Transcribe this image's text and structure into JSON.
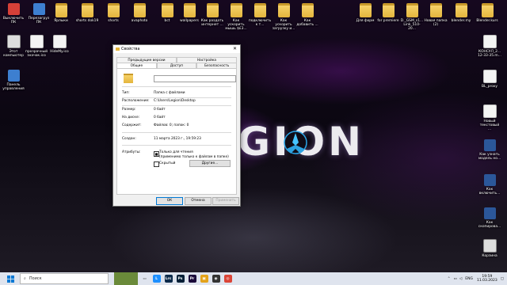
{
  "desktop": {
    "brand_text": "GION",
    "icons_top": [
      {
        "label": "Выключить ПК",
        "kind": "red"
      },
      {
        "label": "Перезагруз ПК",
        "kind": "blue"
      },
      {
        "label": "Ярлыки",
        "kind": "folder"
      },
      {
        "label": "shorts dok19",
        "kind": "folder"
      },
      {
        "label": "shorts",
        "kind": "folder"
      },
      {
        "label": "avaphoto",
        "kind": "folder"
      },
      {
        "label": "bct",
        "kind": "folder"
      },
      {
        "label": "wallpapers",
        "kind": "folder"
      },
      {
        "label": "Как раздать интернет ...",
        "kind": "folder"
      },
      {
        "label": "Как ускорить мышь $£3...",
        "kind": "folder"
      },
      {
        "label": "подключить к т...",
        "kind": "folder"
      },
      {
        "label": "Как ускорить загрузку и...",
        "kind": "folder"
      },
      {
        "label": "Как добавить ...",
        "kind": "folder"
      },
      {
        "label": "Для форм",
        "kind": "folder"
      },
      {
        "label": "for premiere",
        "kind": "folder"
      },
      {
        "label": "D._GSM_s1... Link_510-20...",
        "kind": "folder"
      },
      {
        "label": "Новая папка (2)",
        "kind": "folder"
      },
      {
        "label": "blender.my",
        "kind": "folder"
      },
      {
        "label": "Blender.kurs",
        "kind": "folder"
      }
    ],
    "icons_left": [
      {
        "label": "Этот компьютер",
        "kind": "exe"
      },
      {
        "label": "прозрачный значок.ico",
        "kind": "doc"
      },
      {
        "label": "HideMy.ico",
        "kind": "doc"
      },
      {
        "label": "Панель управления",
        "kind": "blue"
      }
    ],
    "icons_right": [
      {
        "label": "КОНСУЛ_2... 12-33-35.m...",
        "kind": "doc"
      },
      {
        "label": "BL_proxy",
        "kind": "doc"
      },
      {
        "label": "Новый текстовый ...",
        "kind": "doc"
      },
      {
        "label": "Как узнать модель но...",
        "kind": "word"
      },
      {
        "label": "Как включить...",
        "kind": "word"
      },
      {
        "label": "Как скопирова...",
        "kind": "word"
      },
      {
        "label": "Корзина",
        "kind": "exe"
      }
    ]
  },
  "dialog": {
    "title": "Свойства",
    "close_glyph": "✕",
    "tabs_row1": [
      "Предыдущие версии",
      "Настройка"
    ],
    "tabs_row2": [
      "Общие",
      "Доступ",
      "Безопасность"
    ],
    "name_value": "",
    "type_label": "Тип:",
    "type_value": "Папка с файлами",
    "location_label": "Расположение:",
    "location_value": "C:\\Users\\Legion\\Desktop",
    "size_label": "Размер:",
    "size_value": "0 байт",
    "disk_label": "На диске:",
    "disk_value": "0 байт",
    "contains_label": "Содержит:",
    "contains_value": "Файлов: 0; папок: 0",
    "created_label": "Создан:",
    "created_value": "11 марта 2023 г., 19:59:23",
    "attributes_label": "Атрибуты:",
    "readonly_label": "Только для чтения",
    "readonly_sub": "(применимо только к файлам в папке)",
    "hidden_label": "Скрытый",
    "other_button": "Другие...",
    "ok_button": "ОК",
    "cancel_button": "Отмена",
    "apply_button": "Применить"
  },
  "taskbar": {
    "search_placeholder": "Поиск",
    "apps": [
      {
        "name": "landscape",
        "text": "",
        "color": "#6a8a3a"
      },
      {
        "name": "task-view",
        "text": "▭",
        "color": "#dfe4ee"
      },
      {
        "name": "app-l",
        "text": "L",
        "color": "#1e90ff"
      },
      {
        "name": "app-lrc",
        "text": "Lrc",
        "color": "#0c2a4a"
      },
      {
        "name": "app-ps",
        "text": "Ps",
        "color": "#001e36"
      },
      {
        "name": "app-pr",
        "text": "Pr",
        "color": "#1a0a3a"
      },
      {
        "name": "app-explorer",
        "text": "▣",
        "color": "#e3a21a"
      },
      {
        "name": "app-davinci",
        "text": "◉",
        "color": "#333333"
      },
      {
        "name": "app-chrome",
        "text": "◎",
        "color": "#db4437"
      }
    ],
    "lang": "ENG",
    "time": "19:59",
    "date": "11.03.2023"
  }
}
